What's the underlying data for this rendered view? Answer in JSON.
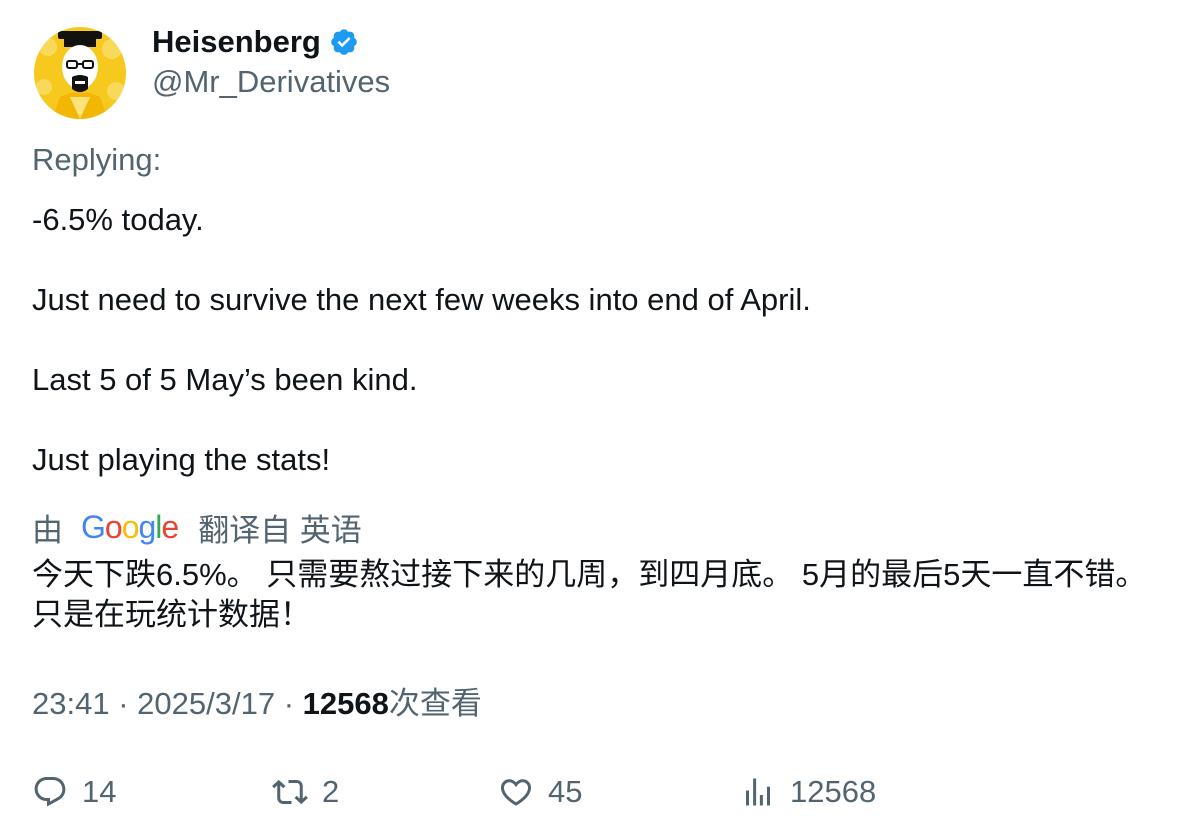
{
  "author": {
    "name": "Heisenberg",
    "handle": "@Mr_Derivatives",
    "verified_icon": "verified-badge-icon",
    "badge_color": "#1d9bf0"
  },
  "replying_label": "Replying:",
  "tweet": {
    "paragraphs": [
      "-6.5% today.",
      "Just need to survive the next few weeks into end of April.",
      "Last 5 of 5 May’s been kind.",
      "Just playing the stats!"
    ]
  },
  "translation": {
    "by_label": "由",
    "provider_letters": [
      {
        "ch": "G",
        "color": "#4285F4"
      },
      {
        "ch": "o",
        "color": "#EA4335"
      },
      {
        "ch": "o",
        "color": "#FBBC05"
      },
      {
        "ch": "g",
        "color": "#4285F4"
      },
      {
        "ch": "l",
        "color": "#34A853"
      },
      {
        "ch": "e",
        "color": "#EA4335"
      }
    ],
    "from_label": "翻译自 英语",
    "text": "今天下跌6.5%。 只需要熬过接下来的几周，到四月底。 5月的最后5天一直不错。 只是在玩统计数据！"
  },
  "meta": {
    "time": "23:41",
    "separator": "·",
    "date": "2025/3/17",
    "views_count": "12568",
    "views_label": "次查看"
  },
  "actions": {
    "replies": "14",
    "retweets": "2",
    "likes": "45",
    "views": "12568"
  },
  "colors": {
    "text_primary": "#0f1419",
    "text_secondary": "#536471",
    "avatar_bg": "#f7c81e"
  }
}
